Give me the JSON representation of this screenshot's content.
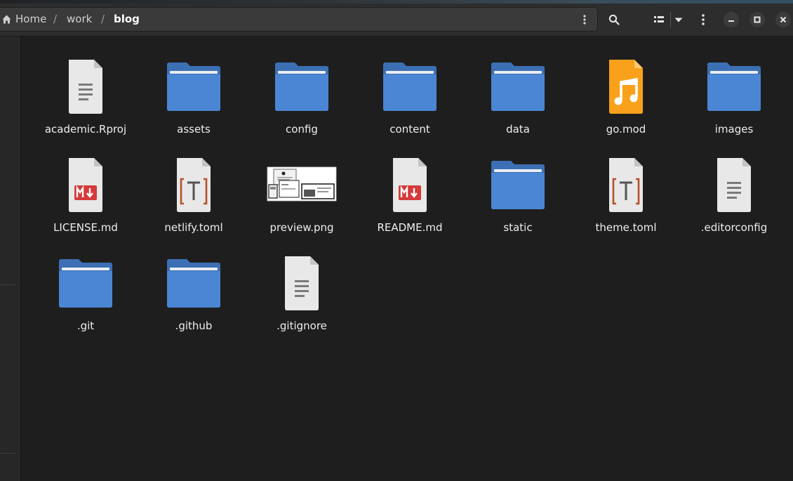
{
  "breadcrumb": {
    "home": "Home",
    "sep": "/",
    "work": "work",
    "current": "blog"
  },
  "icons": {
    "home": "home-icon",
    "path_menu": "vertical-dots-icon",
    "search": "search-icon",
    "view_toggle": "list-view-icon",
    "view_dropdown": "chevron-down-icon",
    "main_menu": "vertical-dots-icon",
    "minimize": "minimize-icon",
    "maximize": "maximize-icon",
    "close": "close-icon"
  },
  "colors": {
    "folder": "#4a86d4",
    "folder_tab": "#3c6fb3",
    "audio": "#f9a11b",
    "markdown": "#d63a3a",
    "toml": "#b5522b"
  },
  "files": [
    {
      "name": "academic.Rproj",
      "type": "text"
    },
    {
      "name": "assets",
      "type": "folder"
    },
    {
      "name": "config",
      "type": "folder"
    },
    {
      "name": "content",
      "type": "folder"
    },
    {
      "name": "data",
      "type": "folder"
    },
    {
      "name": "go.mod",
      "type": "audio"
    },
    {
      "name": "images",
      "type": "folder"
    },
    {
      "name": "LICENSE.md",
      "type": "markdown"
    },
    {
      "name": "netlify.toml",
      "type": "toml"
    },
    {
      "name": "preview.png",
      "type": "image"
    },
    {
      "name": "README.md",
      "type": "markdown"
    },
    {
      "name": "static",
      "type": "folder"
    },
    {
      "name": "theme.toml",
      "type": "toml"
    },
    {
      "name": ".editorconfig",
      "type": "text"
    },
    {
      "name": ".git",
      "type": "folder"
    },
    {
      "name": ".github",
      "type": "folder"
    },
    {
      "name": ".gitignore",
      "type": "text"
    }
  ]
}
